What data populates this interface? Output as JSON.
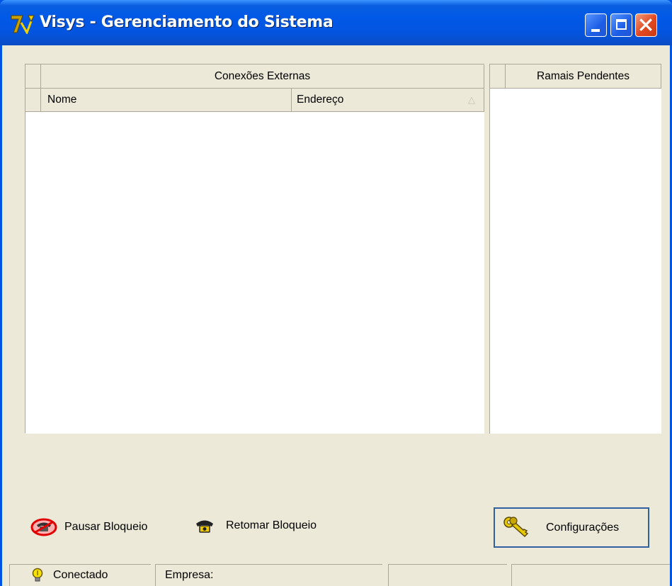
{
  "window": {
    "title": "Visys - Gerenciamento do Sistema"
  },
  "connections": {
    "group_header": "Conexões Externas",
    "columns": [
      "Nome",
      "Endereço"
    ],
    "sort_indicator": "△",
    "rows": []
  },
  "pending": {
    "header": "Ramais Pendentes",
    "rows": []
  },
  "actions": {
    "pause_label": "Pausar Bloqueio",
    "resume_label": "Retomar Bloqueio",
    "settings_label": "Configurações"
  },
  "status": {
    "connection_label": "Conectado",
    "company_label": "Empresa:"
  },
  "colors": {
    "title_bar": "#0058e6",
    "window_bg": "#ece9d8",
    "close_button": "#e0471f",
    "focus_border": "#3060a0"
  },
  "icons": {
    "app": "app-logo-icon",
    "pause": "phone-blocked-icon",
    "resume": "phone-icon",
    "settings": "keys-icon",
    "status": "lightbulb-icon"
  }
}
